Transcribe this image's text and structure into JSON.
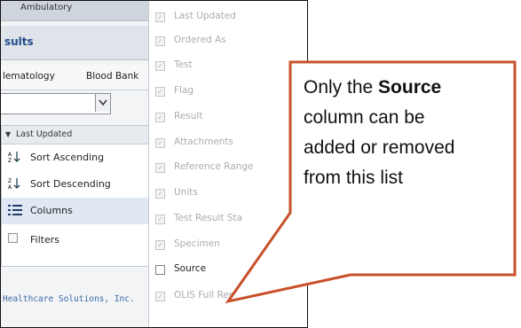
{
  "background": {
    "window_title": "Ambulatory",
    "results_label": "sults",
    "tabs": [
      "lematology",
      "Blood Bank"
    ],
    "dropdown_arrow": "▾",
    "footer": "Healthcare Solutions, Inc."
  },
  "context_menu": {
    "header": "Last Updated",
    "items": [
      {
        "label": "Sort Ascending",
        "icon": "sort-ascending-icon"
      },
      {
        "label": "Sort Descending",
        "icon": "sort-descending-icon"
      },
      {
        "label": "Columns",
        "icon": "columns-icon",
        "has_submenu": true
      },
      {
        "label": "Filters",
        "icon": "checkbox-icon",
        "has_submenu": true
      }
    ]
  },
  "columns_submenu": {
    "items": [
      {
        "label": "Last Updated",
        "checked": true,
        "enabled": false
      },
      {
        "label": "Ordered As",
        "checked": true,
        "enabled": false
      },
      {
        "label": "Test",
        "checked": true,
        "enabled": false
      },
      {
        "label": "Flag",
        "checked": true,
        "enabled": false
      },
      {
        "label": "Result",
        "checked": true,
        "enabled": false
      },
      {
        "label": "Attachments",
        "checked": true,
        "enabled": false
      },
      {
        "label": "Reference Range",
        "checked": true,
        "enabled": false
      },
      {
        "label": "Units",
        "checked": true,
        "enabled": false
      },
      {
        "label": "Test Result Sta",
        "checked": true,
        "enabled": false
      },
      {
        "label": "Specimen",
        "checked": true,
        "enabled": false
      },
      {
        "label": "Source",
        "checked": false,
        "enabled": true
      },
      {
        "label": "OLIS Full Report",
        "checked": true,
        "enabled": false
      }
    ]
  },
  "callout": {
    "line1_prefix": "Only the ",
    "line1_bold": "Source",
    "line2": "column can be",
    "line3": "added or removed",
    "line4": "from this list",
    "border_color": "#c8502a"
  }
}
